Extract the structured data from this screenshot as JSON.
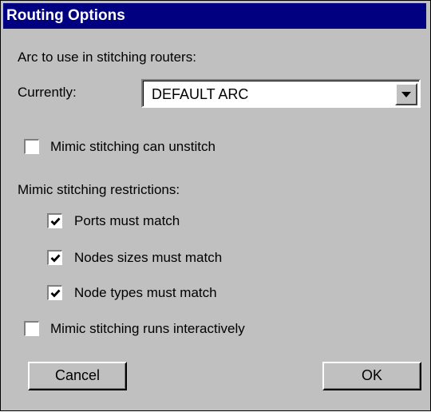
{
  "title": "Routing Options",
  "arc_section_label": "Arc to use in stitching routers:",
  "currently_label": "Currently:",
  "arc_select": {
    "value": "DEFAULT ARC"
  },
  "mimic_unstitch": {
    "label": "Mimic stitching can unstitch",
    "checked": false
  },
  "restrictions_label": "Mimic stitching restrictions:",
  "restrictions": [
    {
      "label": "Ports must match",
      "checked": true
    },
    {
      "label": "Nodes sizes must match",
      "checked": true
    },
    {
      "label": "Node types must match",
      "checked": true
    }
  ],
  "mimic_interactive": {
    "label": "Mimic stitching runs interactively",
    "checked": false
  },
  "buttons": {
    "cancel": "Cancel",
    "ok": "OK"
  },
  "icons": {
    "dropdown": "chevron-down-icon",
    "check": "check-icon"
  },
  "colors": {
    "titlebar": "#000080",
    "dialog_bg": "#c0c0c0"
  }
}
